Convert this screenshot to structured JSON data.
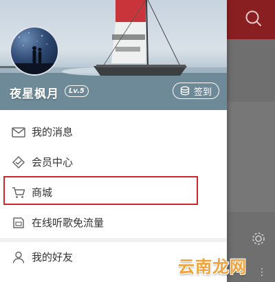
{
  "profile": {
    "username": "夜星枫月",
    "level": "Lv.5",
    "signin_label": "签到"
  },
  "menu": {
    "items": [
      {
        "label": "我的消息",
        "icon": "mail-icon"
      },
      {
        "label": "会员中心",
        "icon": "diamond-icon"
      },
      {
        "label": "商城",
        "icon": "cart-icon"
      },
      {
        "label": "在线听歌免流量",
        "icon": "sim-card-icon"
      },
      {
        "label": "我的好友",
        "icon": "user-icon"
      }
    ]
  },
  "background_app": {
    "icons": [
      "search-icon",
      "gear-icon",
      "more-icon"
    ]
  },
  "watermark": "云南龙网",
  "colors": {
    "accent_red": "#d0232a",
    "header_red": "#8a1f22"
  }
}
